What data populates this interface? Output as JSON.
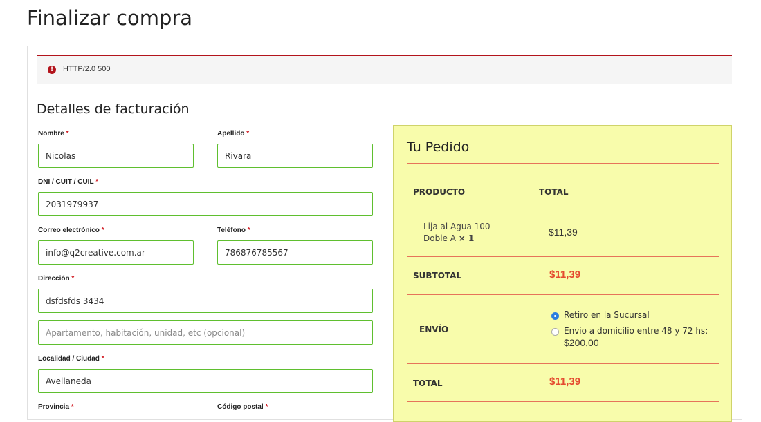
{
  "page_title": "Finalizar compra",
  "error": {
    "icon": "exclamation-icon",
    "message": "HTTP/2.0 500",
    "color": "#b3141c"
  },
  "billing": {
    "title": "Detalles de facturación",
    "required_mark": "*",
    "fields": {
      "first_name": {
        "label": "Nombre",
        "value": "Nicolas"
      },
      "last_name": {
        "label": "Apellido",
        "value": "Rivara"
      },
      "dni": {
        "label": "DNI / CUIT / CUIL",
        "value": "2031979937"
      },
      "email": {
        "label": "Correo electrónico",
        "value": "info@q2creative.com.ar"
      },
      "phone": {
        "label": "Teléfono",
        "value": "786876785567"
      },
      "address": {
        "label": "Dirección",
        "value": "dsfdsfds 3434"
      },
      "address2": {
        "placeholder": "Apartamento, habitación, unidad, etc (opcional)",
        "value": ""
      },
      "city": {
        "label": "Localidad / Ciudad",
        "value": "Avellaneda"
      },
      "province": {
        "label": "Provincia"
      },
      "postcode": {
        "label": "Código postal"
      }
    }
  },
  "order": {
    "title": "Tu Pedido",
    "headers": {
      "product": "PRODUCTO",
      "total": "TOTAL"
    },
    "item": {
      "name": "Lija al Agua 100 - Doble A",
      "qty": "× 1",
      "price": "$11,39"
    },
    "subtotal": {
      "label": "SUBTOTAL",
      "value": "$11,39"
    },
    "shipping": {
      "label": "ENVÍO",
      "options": [
        {
          "label": "Retiro en la Sucursal",
          "checked": true
        },
        {
          "label": "Envio a domicilio entre 48 y 72 hs:",
          "cost": "$200,00",
          "checked": false
        }
      ]
    },
    "total": {
      "label": "TOTAL",
      "value": "$11,39"
    },
    "colors": {
      "panel_bg": "#f8fcab",
      "accent_red": "#e44a2f",
      "field_border": "#5fbf2f"
    }
  }
}
